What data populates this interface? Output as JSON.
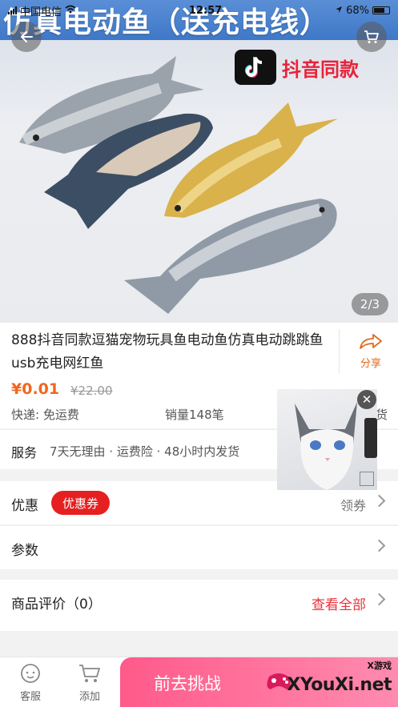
{
  "status_bar": {
    "carrier": "中国电信",
    "time": "12:57",
    "battery": "68%"
  },
  "hero": {
    "banner_text": "仿真电动鱼（送充电线）",
    "brand_text": "抖音同款",
    "image_counter": "2/3"
  },
  "product": {
    "title": "888抖音同款逗猫宠物玩具鱼电动鱼仿真电动跳跳鱼usb充电网红鱼",
    "share_label": "分享",
    "price": "¥0.01",
    "original_price": "¥22.00",
    "delivery": "快递:  免运费",
    "sales": "销量148笔",
    "tail": "货"
  },
  "service": {
    "label": "服务",
    "text": "7天无理由 · 运费险 · 48小时内发货"
  },
  "coupon": {
    "label": "优惠",
    "tag": "优惠券",
    "action": "领券"
  },
  "params": {
    "label": "参数"
  },
  "reviews": {
    "label": "商品评价（0）",
    "link": "查看全部"
  },
  "bottom_bar": {
    "service_label": "客服",
    "add_label": "添加",
    "cta_label": "前去挑战"
  },
  "watermark": {
    "small": "X游戏",
    "big": "XYouXi.net"
  },
  "colors": {
    "accent": "#f0661f",
    "coupon_red": "#e62020",
    "cta_pink": "#ff6b96"
  }
}
